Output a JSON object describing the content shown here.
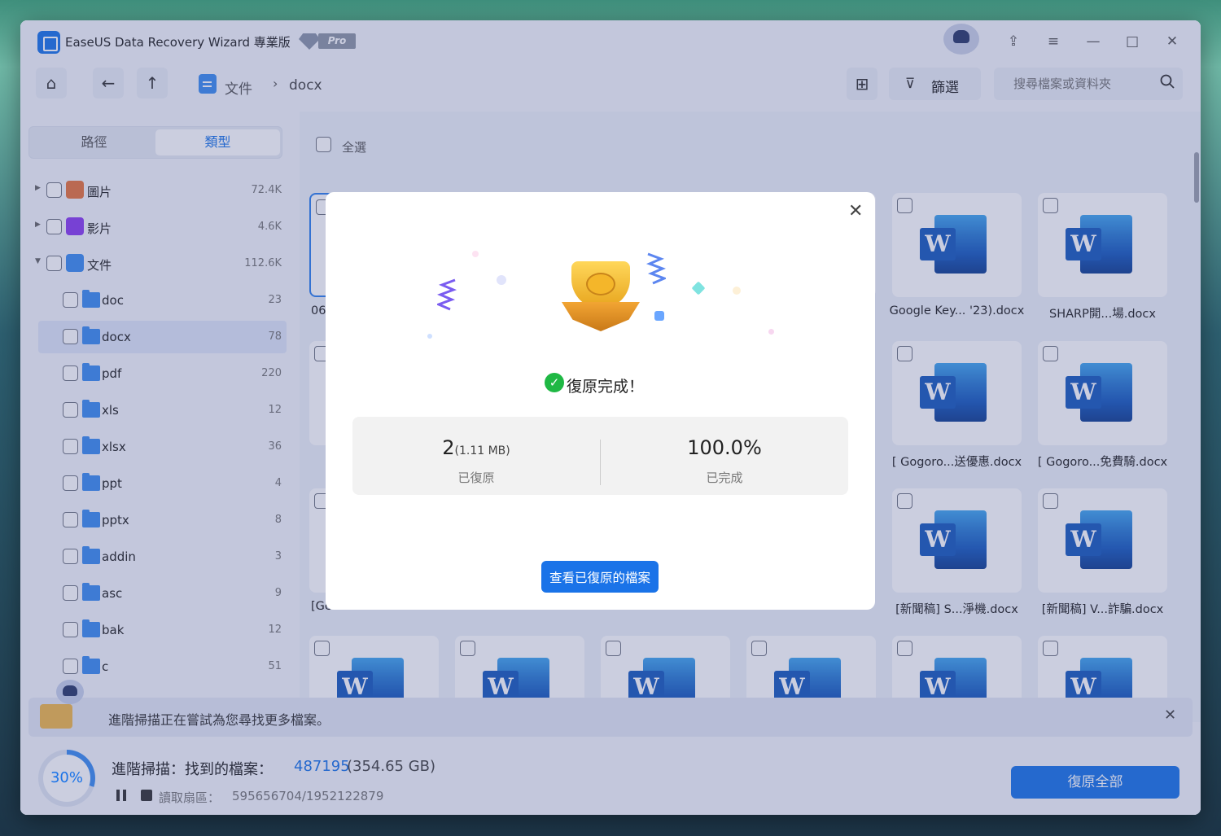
{
  "app": {
    "title": "EaseUS Data Recovery Wizard 專業版",
    "pro_label": "Pro"
  },
  "title_controls": {
    "upgrade": "⇪",
    "menu": "≡",
    "minimize": "—",
    "maximize": "□",
    "close": "✕"
  },
  "toolbar": {
    "home_glyph": "⌂",
    "back_glyph": "←",
    "up_glyph": "↑",
    "breadcrumb": [
      "文件",
      "docx"
    ],
    "breadcrumb_sep": "›",
    "view_glyph": "⊞",
    "filter_glyph": "⊽",
    "filter_label": "篩選",
    "search_placeholder": "搜尋檔案或資料夾"
  },
  "sidebar": {
    "tabs": [
      "路徑",
      "類型"
    ],
    "active_tab": "類型",
    "tree": [
      {
        "label": "圖片",
        "count": "72.4K",
        "icon": "image-icon",
        "level": 0,
        "expand": "collapsed"
      },
      {
        "label": "影片",
        "count": "4.6K",
        "icon": "video-icon",
        "level": 0,
        "expand": "collapsed"
      },
      {
        "label": "文件",
        "count": "112.6K",
        "icon": "document-icon",
        "level": 0,
        "expand": "expanded"
      },
      {
        "label": "doc",
        "count": "23",
        "icon": "folder-icon",
        "level": 1
      },
      {
        "label": "docx",
        "count": "78",
        "icon": "folder-icon",
        "level": 1,
        "selected": true
      },
      {
        "label": "pdf",
        "count": "220",
        "icon": "folder-icon",
        "level": 1
      },
      {
        "label": "xls",
        "count": "12",
        "icon": "folder-icon",
        "level": 1
      },
      {
        "label": "xlsx",
        "count": "36",
        "icon": "folder-icon",
        "level": 1
      },
      {
        "label": "ppt",
        "count": "4",
        "icon": "folder-icon",
        "level": 1
      },
      {
        "label": "pptx",
        "count": "8",
        "icon": "folder-icon",
        "level": 1
      },
      {
        "label": "addin",
        "count": "3",
        "icon": "folder-icon",
        "level": 1
      },
      {
        "label": "asc",
        "count": "9",
        "icon": "folder-icon",
        "level": 1
      },
      {
        "label": "bak",
        "count": "12",
        "icon": "folder-icon",
        "level": 1
      },
      {
        "label": "c",
        "count": "51",
        "icon": "folder-icon",
        "level": 1
      }
    ]
  },
  "content": {
    "select_all_label": "全選",
    "files": [
      {
        "name": "06",
        "col": 0,
        "row": 0
      },
      {
        "name": "",
        "col": 1,
        "row": 0
      },
      {
        "name": "",
        "col": 2,
        "row": 0
      },
      {
        "name": "",
        "col": 3,
        "row": 0
      },
      {
        "name": "Google Key... '23).docx",
        "col": 4,
        "row": 0
      },
      {
        "name": "SHARP開...場.docx",
        "col": 5,
        "row": 0
      },
      {
        "name": "",
        "col": 0,
        "row": 1
      },
      {
        "name": "[ Gogoro...送優惠.docx",
        "col": 4,
        "row": 1
      },
      {
        "name": "[ Gogoro...免費騎.docx",
        "col": 5,
        "row": 1
      },
      {
        "name": "[Gc",
        "col": 0,
        "row": 2
      },
      {
        "name": "[新聞稿] S...淨機.docx",
        "col": 4,
        "row": 2
      },
      {
        "name": "[新聞稿] V...詐騙.docx",
        "col": 5,
        "row": 2
      },
      {
        "name": "",
        "col": 0,
        "row": 3
      },
      {
        "name": "",
        "col": 1,
        "row": 3
      },
      {
        "name": "",
        "col": 2,
        "row": 3
      },
      {
        "name": "",
        "col": 3,
        "row": 3
      },
      {
        "name": "",
        "col": 4,
        "row": 3
      },
      {
        "name": "",
        "col": 5,
        "row": 3
      }
    ]
  },
  "notice": {
    "text": "進階掃描正在嘗試為您尋找更多檔案。",
    "close_glyph": "✕"
  },
  "footer": {
    "progress_percent": 30,
    "progress_text": "30%",
    "scan_label": "進階掃描：找到的檔案：",
    "found_count": "487195",
    "found_size": "(354.65 GB)",
    "sector_label": "讀取扇區：",
    "sector_value": "595656704/1952122879",
    "recover_all_label": "復原全部"
  },
  "modal": {
    "close_glyph": "✕",
    "success_glyph": "✓",
    "success_text": "復原完成！",
    "recovered_count": "2",
    "recovered_size": "(1.11 MB)",
    "recovered_label": "已復原",
    "completed_value": "100.0%",
    "completed_label": "已完成",
    "view_button_label": "查看已復原的檔案"
  },
  "colors": {
    "accent": "#1a73e8",
    "success": "#1fb844",
    "folder": "#3c8cf0"
  }
}
